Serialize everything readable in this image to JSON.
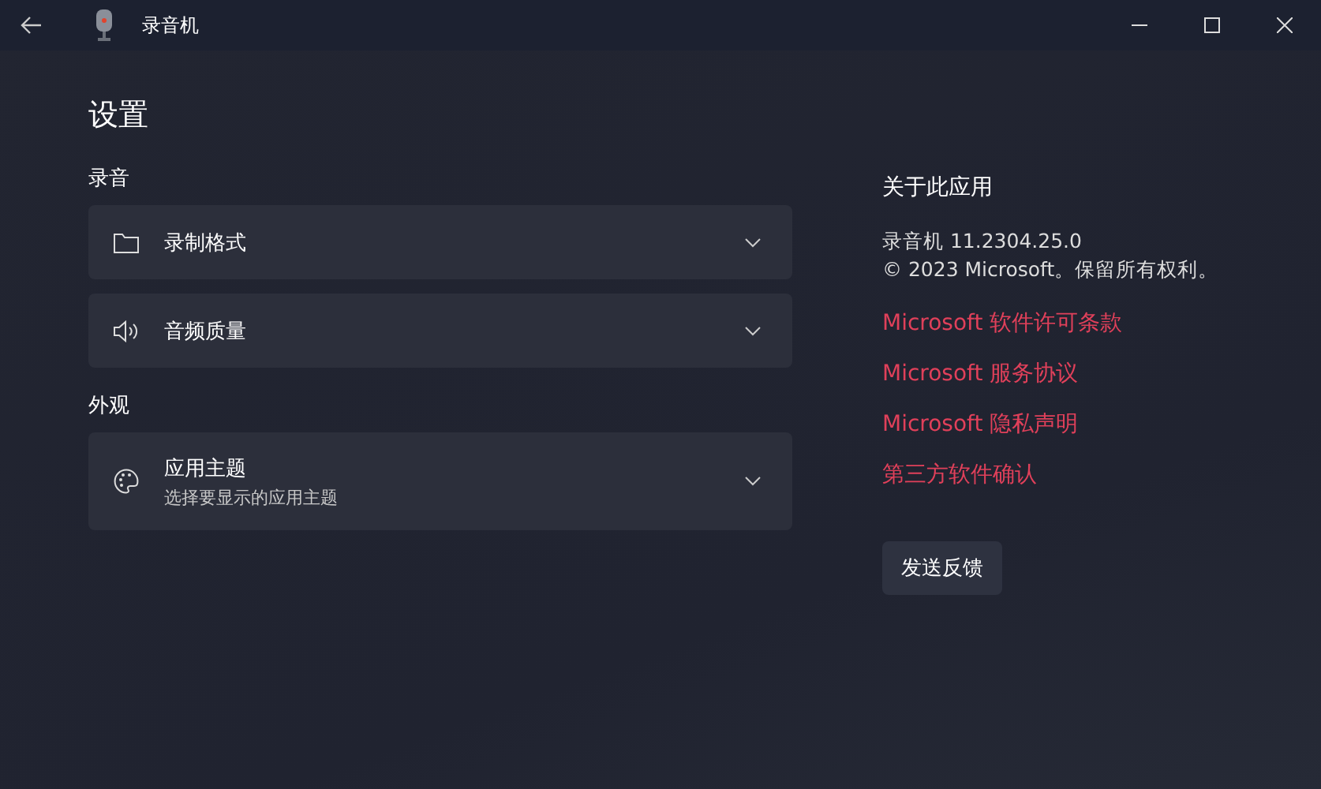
{
  "window": {
    "title": "录音机"
  },
  "page_title": "设置",
  "sections": [
    {
      "heading": "录音",
      "items": [
        {
          "kind": "folder",
          "title": "录制格式"
        },
        {
          "kind": "speaker",
          "title": "音频质量"
        }
      ]
    },
    {
      "heading": "外观",
      "items": [
        {
          "kind": "palette",
          "title": "应用主题",
          "subtitle": "选择要显示的应用主题"
        }
      ]
    }
  ],
  "about": {
    "heading": "关于此应用",
    "version": "录音机 11.2304.25.0",
    "copyright": "© 2023 Microsoft。保留所有权利。",
    "links": [
      "Microsoft 软件许可条款",
      "Microsoft 服务协议",
      "Microsoft 隐私声明",
      "第三方软件确认"
    ],
    "button": "发送反馈"
  }
}
